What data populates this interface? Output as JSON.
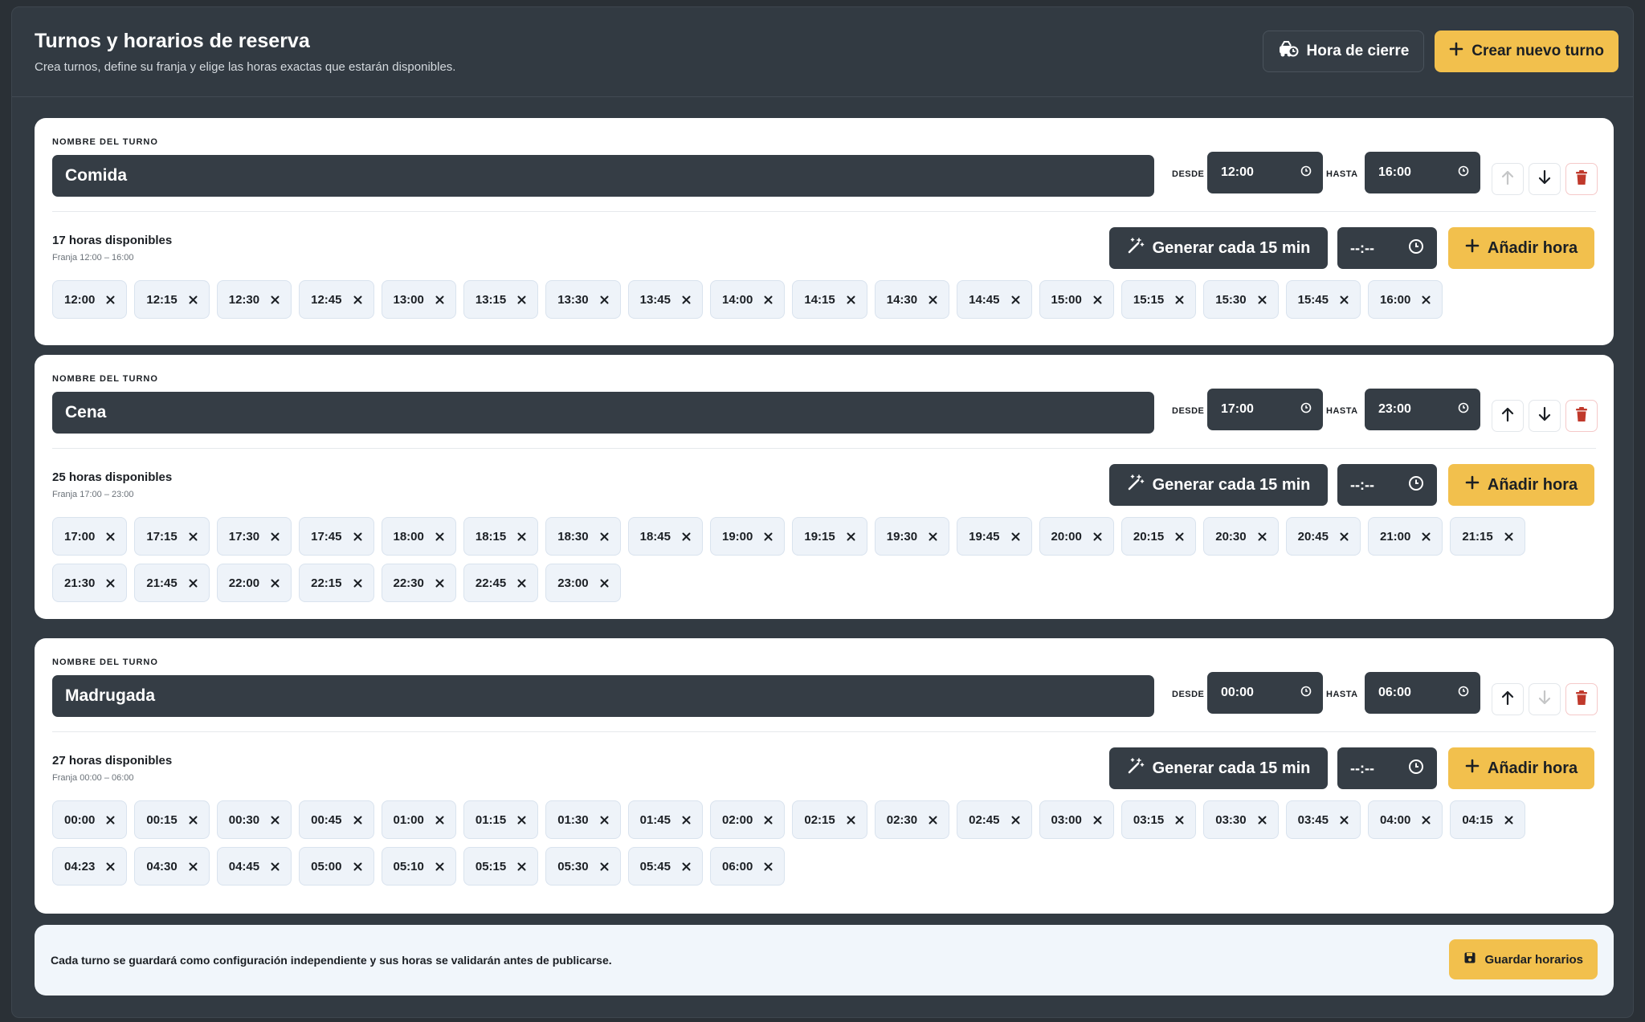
{
  "header": {
    "title": "Turnos y horarios de reserva",
    "subtitle": "Crea turnos, define su franja y elige las horas exactas que estarán disponibles.",
    "closing_label": "Hora de cierre",
    "new_label": "Crear nuevo turno"
  },
  "labels": {
    "shift_name": "NOMBRE DEL TURNO",
    "from": "DESDE",
    "to": "HASTA",
    "generate": "Generar cada 15 min",
    "time_placeholder": "--:--",
    "add_time": "Añadir hora"
  },
  "shifts": [
    {
      "name": "Comida",
      "from": "12:00",
      "to": "16:00",
      "count": "17 horas disponibles",
      "franja": "Franja 12:00 – 16:00",
      "can_up": false,
      "can_down": true,
      "times": [
        "12:00",
        "12:15",
        "12:30",
        "12:45",
        "13:00",
        "13:15",
        "13:30",
        "13:45",
        "14:00",
        "14:15",
        "14:30",
        "14:45",
        "15:00",
        "15:15",
        "15:30",
        "15:45",
        "16:00"
      ]
    },
    {
      "name": "Cena",
      "from": "17:00",
      "to": "23:00",
      "count": "25 horas disponibles",
      "franja": "Franja 17:00 – 23:00",
      "can_up": true,
      "can_down": true,
      "times": [
        "17:00",
        "17:15",
        "17:30",
        "17:45",
        "18:00",
        "18:15",
        "18:30",
        "18:45",
        "19:00",
        "19:15",
        "19:30",
        "19:45",
        "20:00",
        "20:15",
        "20:30",
        "20:45",
        "21:00",
        "21:15",
        "21:30",
        "21:45",
        "22:00",
        "22:15",
        "22:30",
        "22:45",
        "23:00"
      ]
    },
    {
      "name": "Madrugada",
      "from": "00:00",
      "to": "06:00",
      "count": "27 horas disponibles",
      "franja": "Franja 00:00 – 06:00",
      "can_up": true,
      "can_down": false,
      "times": [
        "00:00",
        "00:15",
        "00:30",
        "00:45",
        "01:00",
        "01:15",
        "01:30",
        "01:45",
        "02:00",
        "02:15",
        "02:30",
        "02:45",
        "03:00",
        "03:15",
        "03:30",
        "03:45",
        "04:00",
        "04:15",
        "04:23",
        "04:30",
        "04:45",
        "05:00",
        "05:10",
        "05:15",
        "05:30",
        "05:45",
        "06:00"
      ]
    }
  ],
  "footer": {
    "note": "Cada turno se guardará como configuración independiente y sus horas se validarán antes de publicarse.",
    "save_label": "Guardar horarios"
  },
  "colors": {
    "accent": "#f2c04d",
    "dark": "#353d45",
    "danger": "#c0392b"
  }
}
